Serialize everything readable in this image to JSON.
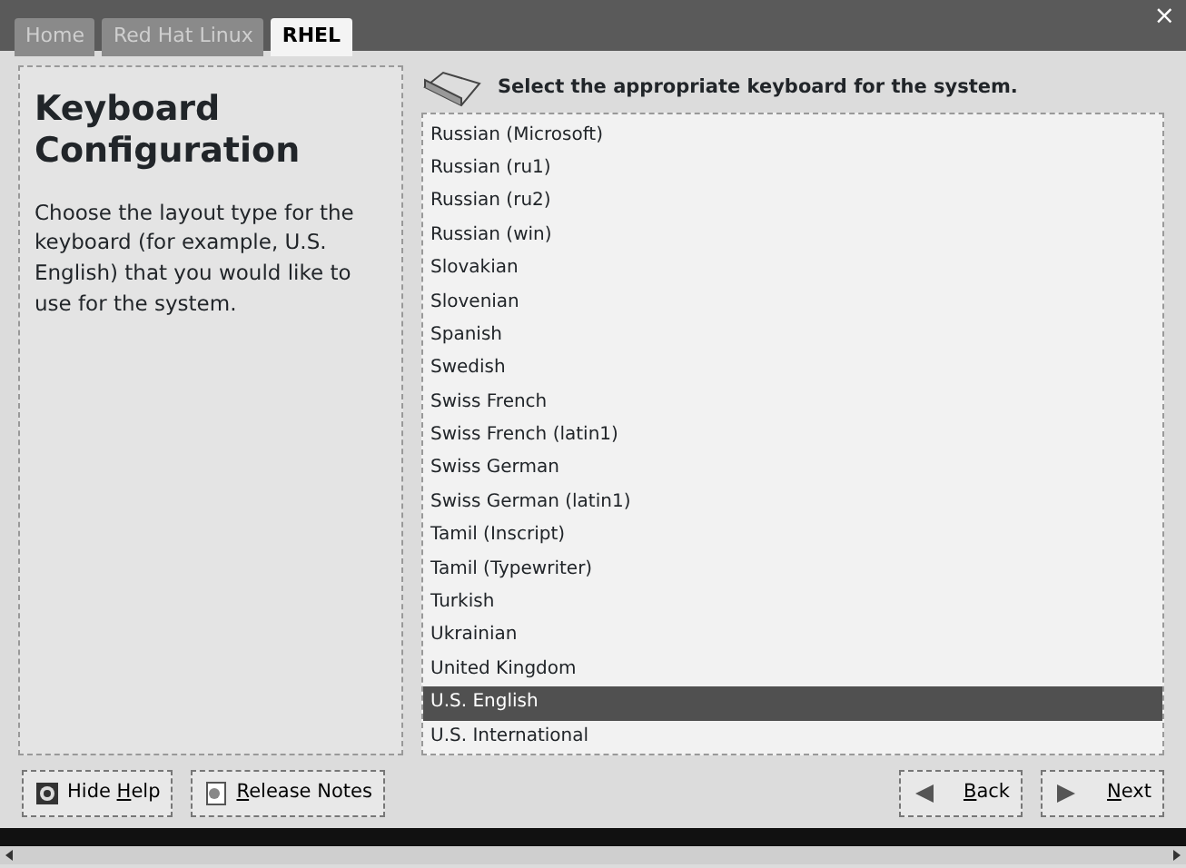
{
  "tabs": [
    {
      "label": "Home",
      "selected": false
    },
    {
      "label": "Red Hat Linux",
      "selected": false
    },
    {
      "label": "RHEL",
      "selected": true
    }
  ],
  "help": {
    "title": "Keyboard Configuration",
    "text": "Choose the layout type for the keyboard (for example, U.S. English) that you would like to use for the system."
  },
  "prompt": "Select the appropriate keyboard for the system.",
  "keyboards": [
    {
      "label": "Russian (Microsoft)",
      "selected": false
    },
    {
      "label": "Russian (ru1)",
      "selected": false
    },
    {
      "label": "Russian (ru2)",
      "selected": false
    },
    {
      "label": "Russian (win)",
      "selected": false
    },
    {
      "label": "Slovakian",
      "selected": false
    },
    {
      "label": "Slovenian",
      "selected": false
    },
    {
      "label": "Spanish",
      "selected": false
    },
    {
      "label": "Swedish",
      "selected": false
    },
    {
      "label": "Swiss French",
      "selected": false
    },
    {
      "label": "Swiss French (latin1)",
      "selected": false
    },
    {
      "label": "Swiss German",
      "selected": false
    },
    {
      "label": "Swiss German (latin1)",
      "selected": false
    },
    {
      "label": "Tamil (Inscript)",
      "selected": false
    },
    {
      "label": "Tamil (Typewriter)",
      "selected": false
    },
    {
      "label": "Turkish",
      "selected": false
    },
    {
      "label": "Ukrainian",
      "selected": false
    },
    {
      "label": "United Kingdom",
      "selected": false
    },
    {
      "label": "U.S. English",
      "selected": true
    },
    {
      "label": "U.S. International",
      "selected": false
    }
  ],
  "buttons": [
    {
      "kind": "help",
      "label": "Hide **H**elp"
    },
    {
      "kind": "notes",
      "label": "**R**elease Notes"
    },
    {
      "kind": "back",
      "label": "**B**ack"
    },
    {
      "kind": "next",
      "label": "**N**ext"
    }
  ],
  "close": "×"
}
